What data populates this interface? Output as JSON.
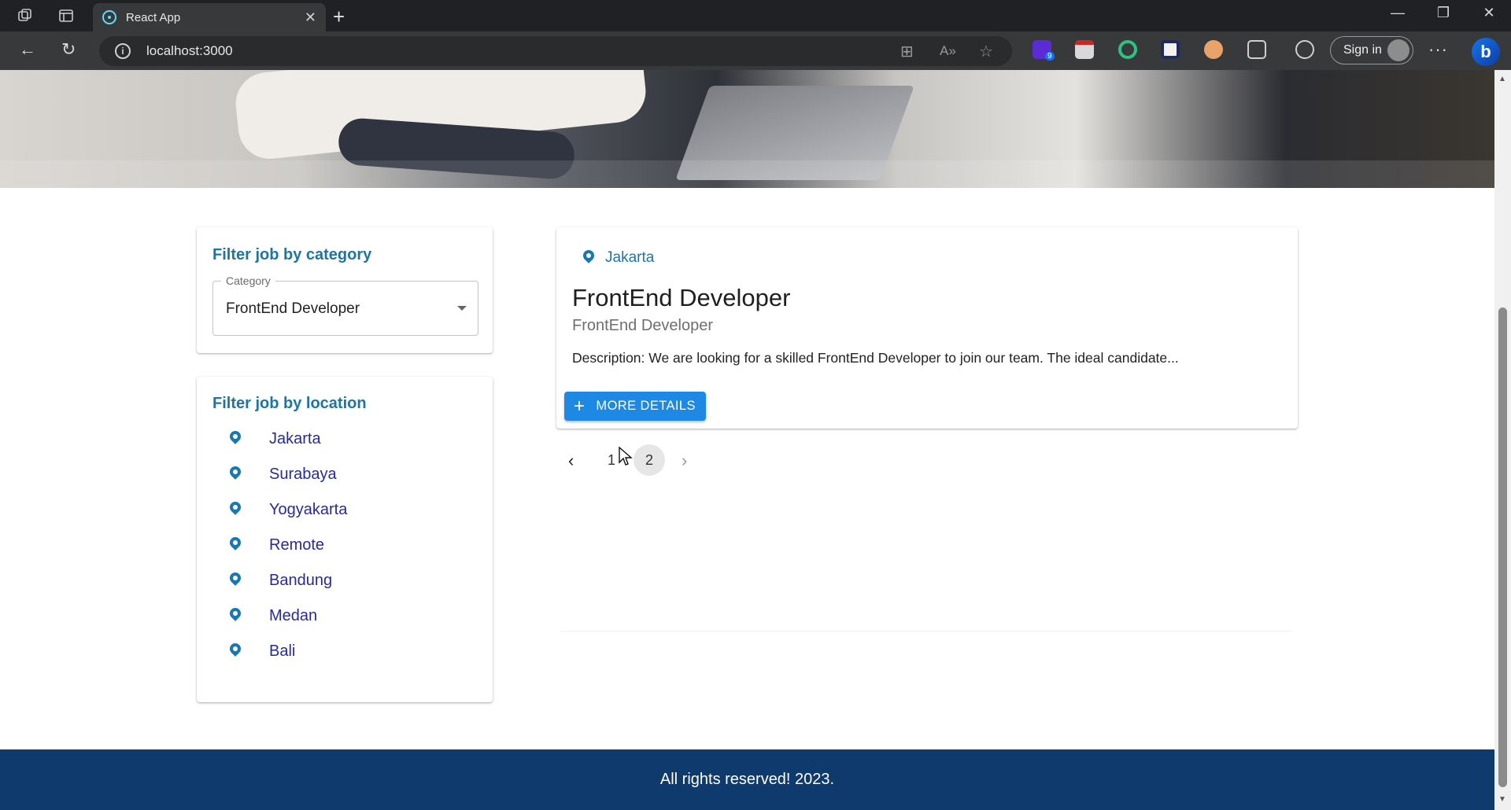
{
  "browser": {
    "tab_title": "React App",
    "url": "localhost:3000",
    "signin_label": "Sign in",
    "extension_badge": "9"
  },
  "filters": {
    "category": {
      "title": "Filter job by category",
      "select_label": "Category",
      "selected_value": "FrontEnd Developer"
    },
    "location": {
      "title": "Filter job by location",
      "items": [
        "Jakarta",
        "Surabaya",
        "Yogyakarta",
        "Remote",
        "Bandung",
        "Medan",
        "Bali"
      ]
    }
  },
  "job": {
    "location": "Jakarta",
    "title": "FrontEnd Developer",
    "category": "FrontEnd Developer",
    "description": "Description: We are looking for a skilled FrontEnd Developer to join our team. The ideal candidate...",
    "button_label": "MORE DETAILS"
  },
  "pagination": {
    "pages": [
      "1",
      "2"
    ],
    "current": "1"
  },
  "footer": {
    "text": "All rights reserved! 2023."
  },
  "colors": {
    "accent": "#1e88e5",
    "heading": "#1d75a6",
    "footer_bg": "#0e3a6e"
  }
}
